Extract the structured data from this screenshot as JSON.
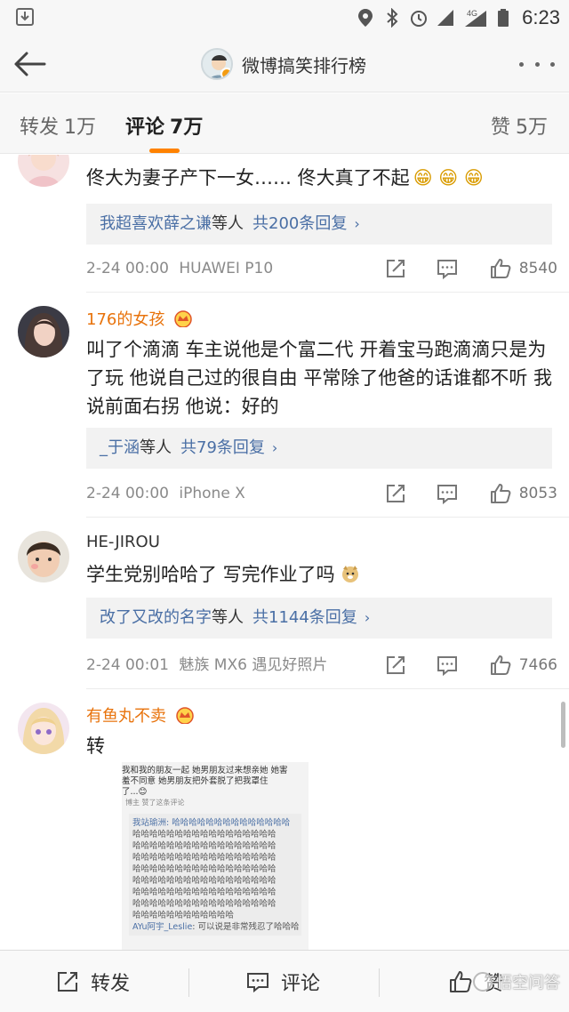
{
  "status_bar": {
    "time": "6:23",
    "network": "4G"
  },
  "header": {
    "title": "微博搞笑排行榜"
  },
  "tabs": [
    {
      "label": "转发",
      "count": "1万"
    },
    {
      "label": "评论",
      "count": "7万"
    },
    {
      "label": "赞",
      "count": "5万"
    }
  ],
  "comments": [
    {
      "username": "",
      "text": "佟大为妻子产下一女…… 佟大真了不起",
      "emoji": "😁 😁 😁",
      "reply_names": "我超喜欢薛之谦",
      "reply_suffix": "等人",
      "reply_total": "共200条回复",
      "time": "2-24 00:00",
      "device": "HUAWEI P10",
      "likes": "8540"
    },
    {
      "username": "176的女孩",
      "text": "叫了个滴滴 车主说他是个富二代 开着宝马跑滴滴只是为了玩 他说自己过的很自由 平常除了他爸的话谁都不听 我说前面右拐 他说：好的",
      "reply_names": "_于涵",
      "reply_suffix": "等人",
      "reply_total": "共79条回复",
      "time": "2-24 00:00",
      "device": "iPhone X",
      "likes": "8053"
    },
    {
      "username": "HE-JIROU",
      "text": "学生党别哈哈了 写完作业了吗",
      "reply_names": "改了又改的名字",
      "reply_suffix": "等人",
      "reply_total": "共1144条回复",
      "time": "2-24 00:01",
      "device": "魅族 MX6 遇见好照片",
      "likes": "7466"
    },
    {
      "username": "有鱼丸不卖",
      "text": "转"
    }
  ],
  "embedded_image": {
    "lines": [
      "我和我的朋友一起 她男朋友过来想亲她 她害",
      "羞不同意 她男朋友把外套脱了把我罩住",
      "了...😊"
    ],
    "liked_note": "博主 赞了这条评论",
    "quote_lines": [
      "我站瑜洲: 哈哈哈哈哈哈哈哈哈哈哈哈哈哈",
      "哈哈哈哈哈哈哈哈哈哈哈哈哈哈哈哈哈",
      "哈哈哈哈哈哈哈哈哈哈哈哈哈哈哈哈哈",
      "哈哈哈哈哈哈哈哈哈哈哈哈哈哈哈哈哈",
      "哈哈哈哈哈哈哈哈哈哈哈哈哈哈哈哈哈",
      "哈哈哈哈哈哈哈哈哈哈哈哈哈哈哈哈哈",
      "哈哈哈哈哈哈哈哈哈哈哈哈哈哈哈哈哈",
      "哈哈哈哈哈哈哈哈哈哈哈哈哈哈哈哈哈",
      "哈哈哈哈哈哈哈哈哈哈哈哈"
    ],
    "reply_line_name": "AYu阿宇_Leslie",
    "reply_line_text": ": 可以说是非常残忍了哈哈哈"
  },
  "bottom_bar": {
    "repost": "转发",
    "comment": "评论",
    "like": "赞",
    "watermark": "悟空问答"
  }
}
